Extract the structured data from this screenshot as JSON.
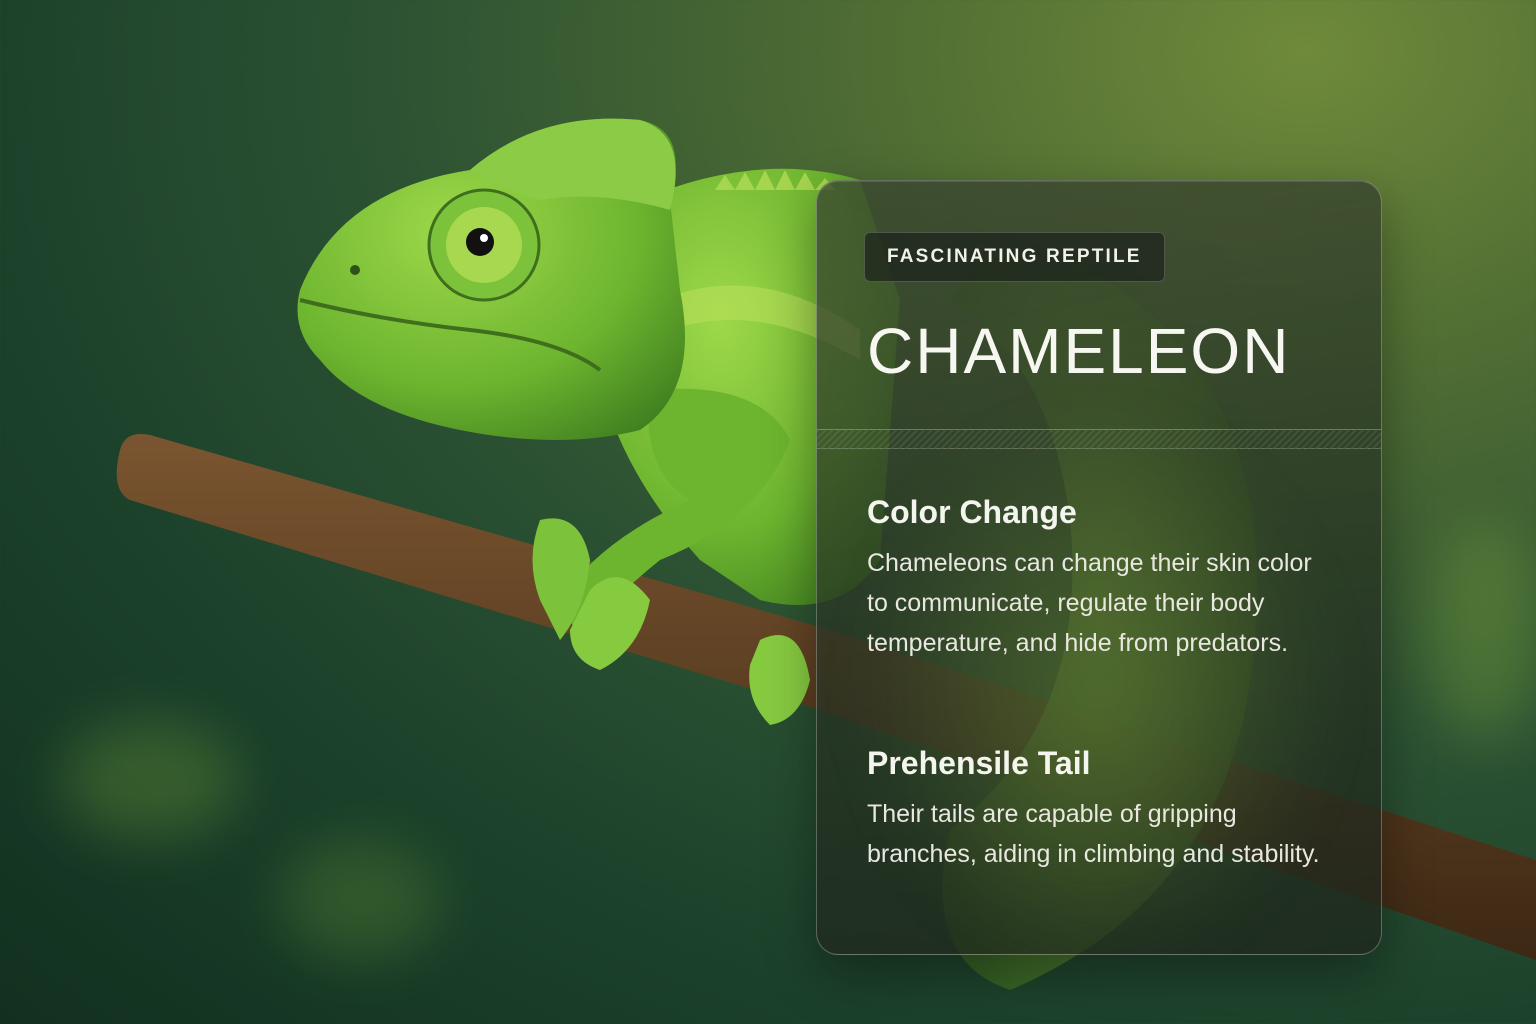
{
  "card": {
    "badge": "FASCINATING REPTILE",
    "title": "CHAMELEON",
    "sections": [
      {
        "heading": "Color Change",
        "text": "Chameleons can change their skin color to communicate, regulate their body temperature, and hide from predators."
      },
      {
        "heading": "Prehensile Tail",
        "text": "Their tails are capable of gripping branches, aiding in climbing and stability."
      }
    ]
  },
  "colors": {
    "background_dark": "#12301f",
    "background_light": "#6f8a3a",
    "chameleon_green": "#7cc23a",
    "branch_brown": "#5a3d20"
  }
}
